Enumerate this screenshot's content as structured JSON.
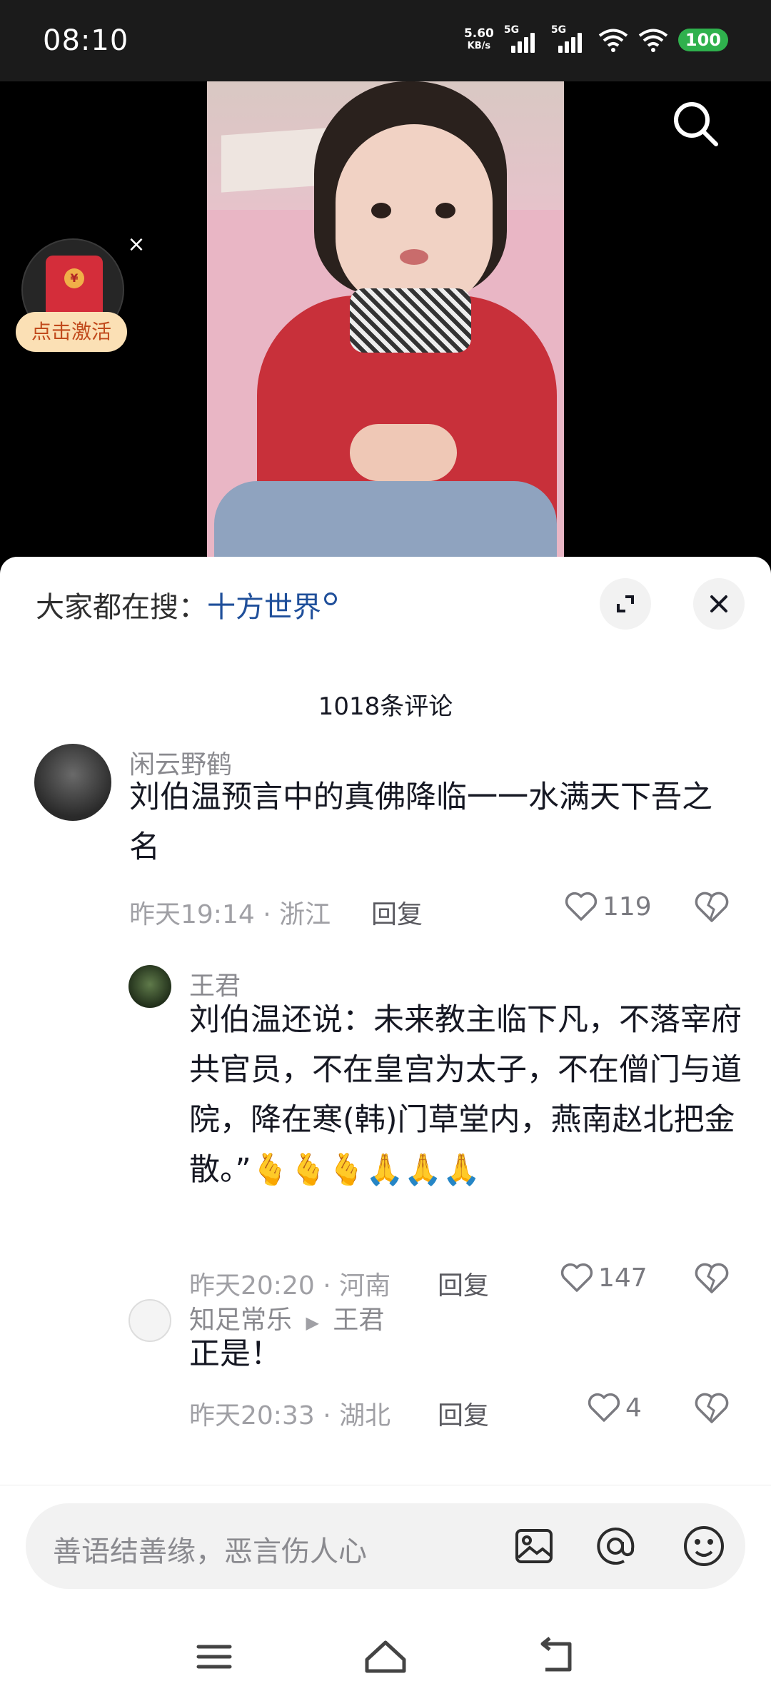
{
  "status_bar": {
    "time": "08:10",
    "net_speed_value": "5.60",
    "net_speed_unit": "KB/s",
    "signal1_label": "5G",
    "signal2_label": "5G",
    "battery": "100"
  },
  "video": {
    "redpacket_label": "点击激活"
  },
  "panel": {
    "hot_search_prefix": "大家都在搜：",
    "hot_search_keyword": "十方世界",
    "comment_count": "1018条评论"
  },
  "comments": [
    {
      "username": "闲云野鹤",
      "text": "刘伯温预言中的真佛降临一一水满天下吾之名",
      "time_location": "昨天19:14 · 浙江",
      "reply_label": "回复",
      "likes": "119"
    },
    {
      "username": "王君",
      "text": "刘伯温还说：未来教主临下凡，不落宰府共官员，不在皇宫为太子，不在僧门与道院，降在寒(韩)门草堂内，燕南赵北把金散。”🫰🫰🫰🙏🙏🙏",
      "time_location": "昨天20:20 · 河南",
      "reply_label": "回复",
      "likes": "147"
    },
    {
      "username": "知足常乐",
      "reply_to": "王君",
      "text": "正是！",
      "time_location": "昨天20:33 · 湖北",
      "reply_label": "回复",
      "likes": "4"
    }
  ],
  "input_bar": {
    "placeholder": "善语结善缘，恶言伤人心"
  }
}
